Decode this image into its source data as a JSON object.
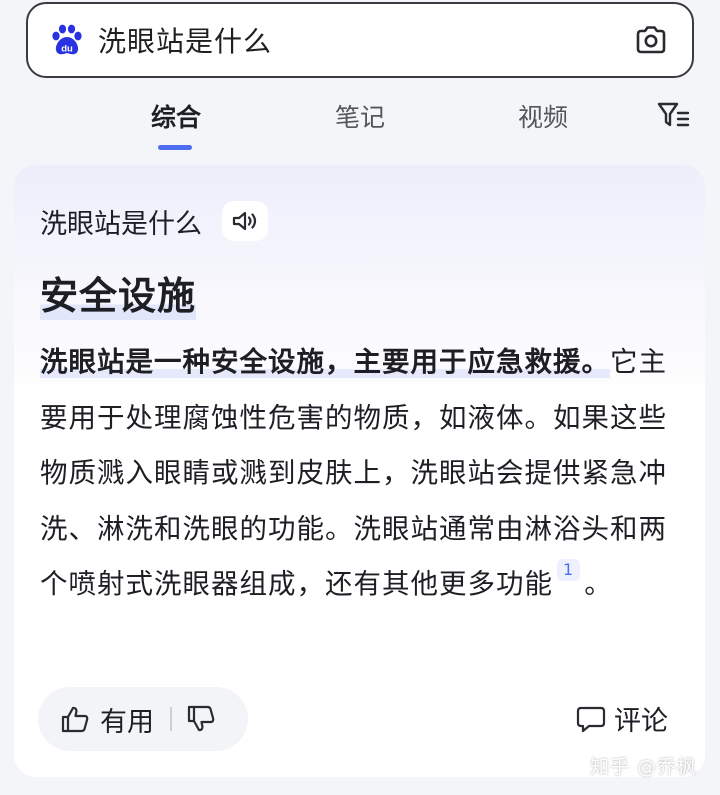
{
  "search": {
    "query": "洗眼站是什么",
    "logo_icon": "baidu-paw-logo",
    "camera_icon": "camera-icon"
  },
  "tabs": [
    {
      "label": "综合",
      "active": true
    },
    {
      "label": "笔记",
      "active": false
    },
    {
      "label": "视频",
      "active": false
    }
  ],
  "filter_icon": "filter-icon",
  "answer": {
    "query": "洗眼站是什么",
    "title": "安全设施",
    "highlight": "洗眼站是一种安全设施，主要用于应急救援。",
    "body": "它主要用于处理腐蚀性危害的物质，如液体。如果这些物质溅入眼睛或溅到皮肤上，洗眼站会提供紧急冲洗、淋洗和洗眼的功能。洗眼站通常由淋浴头和两个喷射式洗眼器组成，还有其他更多功能",
    "citation": "1",
    "end": "。"
  },
  "actions": {
    "useful_label": "有用",
    "comment_label": "评论"
  },
  "watermark": "知乎 @乔枫",
  "colors": {
    "accent": "#4e6ef2",
    "baidu_blue": "#2932e1",
    "text": "#1e1f24"
  }
}
